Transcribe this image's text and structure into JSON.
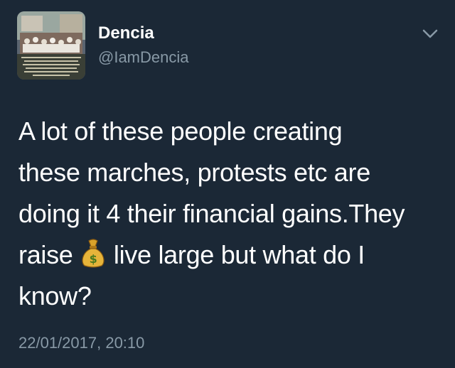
{
  "author": {
    "display_name": "Dencia",
    "handle": "@IamDencia"
  },
  "tweet": {
    "lines": [
      "A lot of these people creating",
      "these marches, protests etc are",
      "doing it 4 their financial gains.They"
    ],
    "line4_before": "raise ",
    "line4_emoji": "money-bag",
    "line4_after": " live large but what do I",
    "line5": "know?"
  },
  "timestamp": "22/01/2017, 20:10",
  "icons": {
    "menu": "chevron-down-icon",
    "emoji": "money-bag-icon"
  },
  "colors": {
    "background": "#1b2836",
    "secondary_text": "#8899a6"
  }
}
